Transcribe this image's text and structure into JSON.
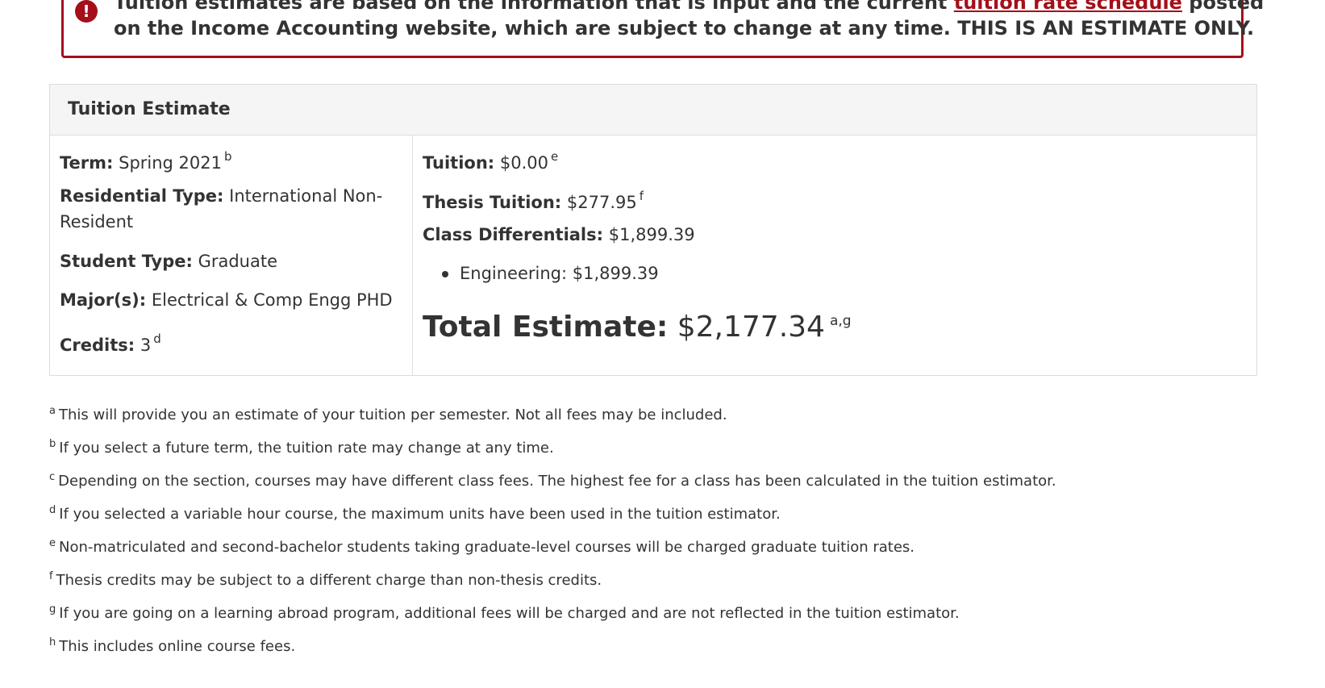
{
  "alert": {
    "icon": "exclamation-circle-icon",
    "text_part1": "Tuition estimates are based on the information that is input and the current ",
    "link_text": "tuition rate schedule",
    "text_part2": " posted",
    "line2": "on the Income Accounting website, which are subject to change at any time. THIS IS AN ESTIMATE ONLY.",
    "border_color": "#a40f1a"
  },
  "panel": {
    "title": "Tuition Estimate",
    "left": {
      "term_label": "Term:",
      "term_value": "Spring 2021",
      "term_note": "b",
      "residential_label": "Residential Type:",
      "residential_value_line1": "International Non-",
      "residential_value_line2": "Resident",
      "student_label": "Student Type:",
      "student_value": "Graduate",
      "major_label": "Major(s):",
      "major_value": "Electrical & Comp Engg PHD",
      "credits_label": "Credits:",
      "credits_value": "3",
      "credits_note": "d"
    },
    "right": {
      "tuition_label": "Tuition:",
      "tuition_value": "$0.00",
      "tuition_note": "e",
      "thesis_label": "Thesis Tuition:",
      "thesis_value": "$277.95",
      "thesis_note": "f",
      "class_diff_label": "Class Differentials:",
      "class_diff_value": "$1,899.39",
      "diff_items": [
        "Engineering: $1,899.39"
      ],
      "total_label": "Total Estimate:",
      "total_value": "$2,177.34",
      "total_note": "a,g"
    }
  },
  "footnotes": [
    {
      "mark": "a",
      "text": "This will provide you an estimate of your tuition per semester. Not all fees may be included."
    },
    {
      "mark": "b",
      "text": "If you select a future term, the tuition rate may change at any time."
    },
    {
      "mark": "c",
      "text": "Depending on the section, courses may have different class fees. The highest fee for a class has been calculated in the tuition estimator."
    },
    {
      "mark": "d",
      "text": "If you selected a variable hour course, the maximum units have been used in the tuition estimator."
    },
    {
      "mark": "e",
      "text": "Non-matriculated and second-bachelor students taking graduate-level courses will be charged graduate tuition rates."
    },
    {
      "mark": "f",
      "text": "Thesis credits may be subject to a different charge than non-thesis credits."
    },
    {
      "mark": "g",
      "text": "If you are going on a learning abroad program, additional fees will be charged and are not reflected in the tuition estimator."
    },
    {
      "mark": "h",
      "text": "This includes online course fees."
    }
  ]
}
